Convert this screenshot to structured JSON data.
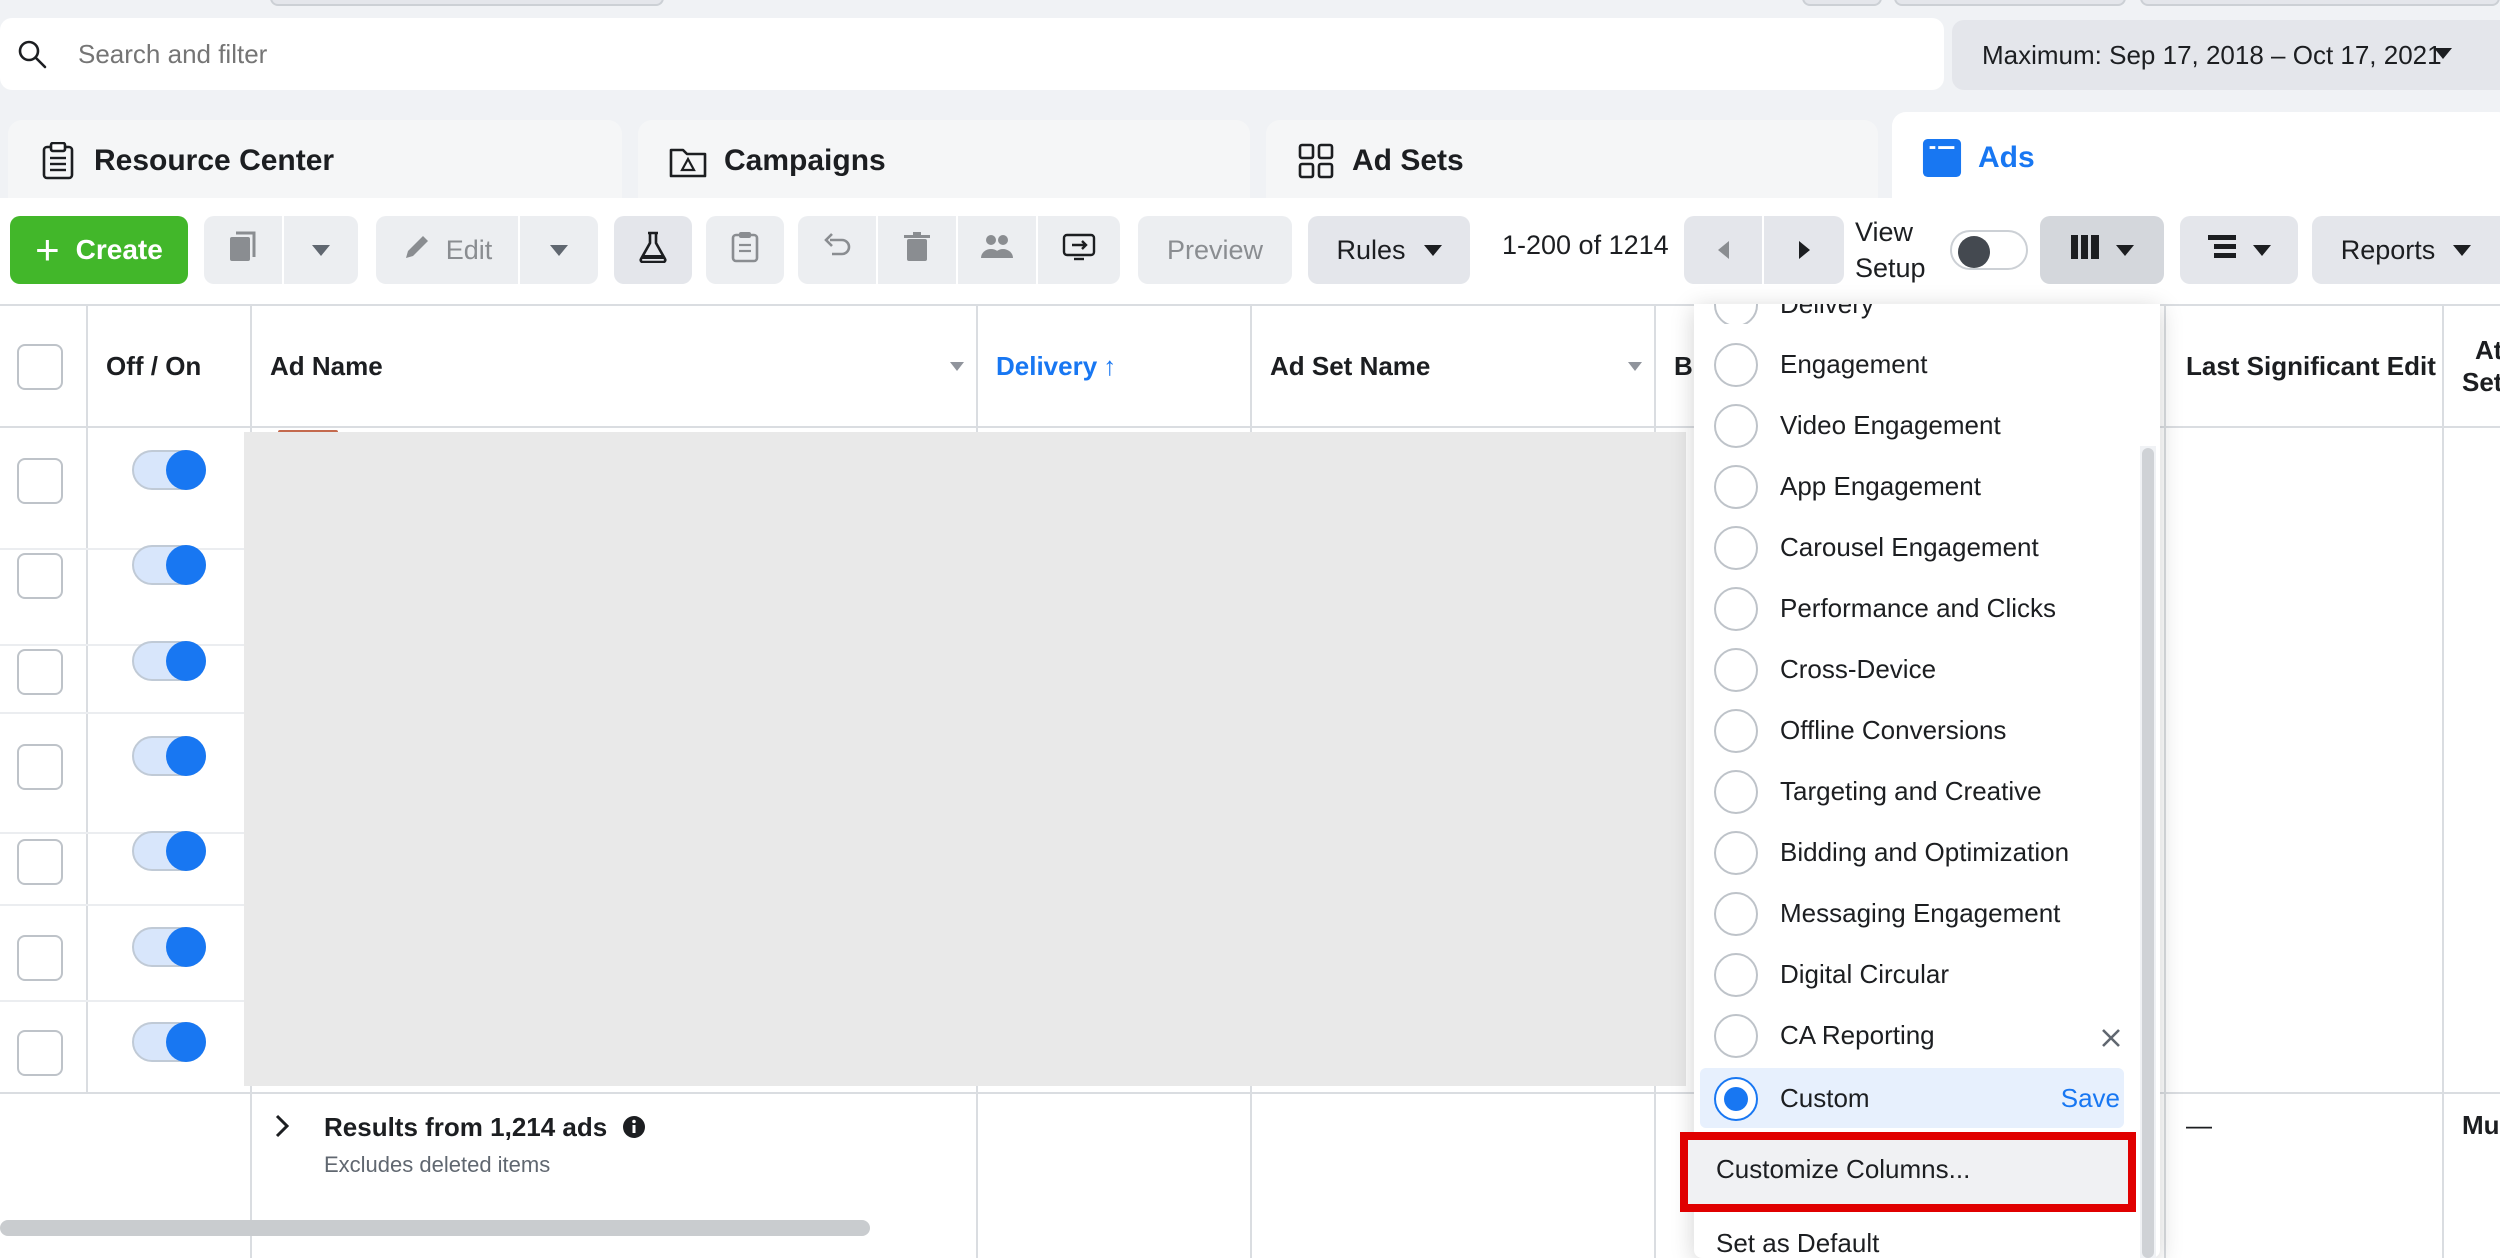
{
  "search": {
    "placeholder": "Search and filter"
  },
  "date_range": {
    "label": "Maximum: Sep 17, 2018 – Oct 17, 2021"
  },
  "tabs": [
    {
      "label": "Resource Center",
      "icon": "clipboard-icon"
    },
    {
      "label": "Campaigns",
      "icon": "folder-icon"
    },
    {
      "label": "Ad Sets",
      "icon": "grid-icon"
    },
    {
      "label": "Ads",
      "icon": "ad-window-icon",
      "active": true
    }
  ],
  "toolbar": {
    "create_label": "Create",
    "edit_label": "Edit",
    "preview_label": "Preview",
    "rules_label": "Rules",
    "page_count": "1-200 of 1214",
    "view_setup_line1": "View",
    "view_setup_line2": "Setup",
    "reports_label": "Reports"
  },
  "table": {
    "columns": {
      "off_on": "Off / On",
      "ad_name": "Ad Name",
      "delivery": "Delivery",
      "delivery_sort": "↑",
      "ad_set_name": "Ad Set Name",
      "b_partial": "B",
      "last_edit": "Last Significant Edit",
      "at_partial_1": "At",
      "at_partial_2": "Set"
    },
    "row_count": 7,
    "footer": {
      "title": "Results from 1,214 ads",
      "subtitle": "Excludes deleted items",
      "dash": "—",
      "mu_partial": "Mu"
    }
  },
  "columns_dropdown": {
    "items": [
      {
        "label": "Delivery"
      },
      {
        "label": "Engagement"
      },
      {
        "label": "Video Engagement"
      },
      {
        "label": "App Engagement"
      },
      {
        "label": "Carousel Engagement"
      },
      {
        "label": "Performance and Clicks"
      },
      {
        "label": "Cross-Device"
      },
      {
        "label": "Offline Conversions"
      },
      {
        "label": "Targeting and Creative"
      },
      {
        "label": "Bidding and Optimization"
      },
      {
        "label": "Messaging Engagement"
      },
      {
        "label": "Digital Circular"
      },
      {
        "label": "CA Reporting",
        "removable": true
      },
      {
        "label": "Custom",
        "checked": true,
        "save_label": "Save"
      }
    ],
    "customize_label": "Customize Columns...",
    "set_default_label": "Set as Default"
  },
  "colors": {
    "primary": "#1877f2",
    "create_green": "#42b72a",
    "highlight_red": "#e00000"
  }
}
